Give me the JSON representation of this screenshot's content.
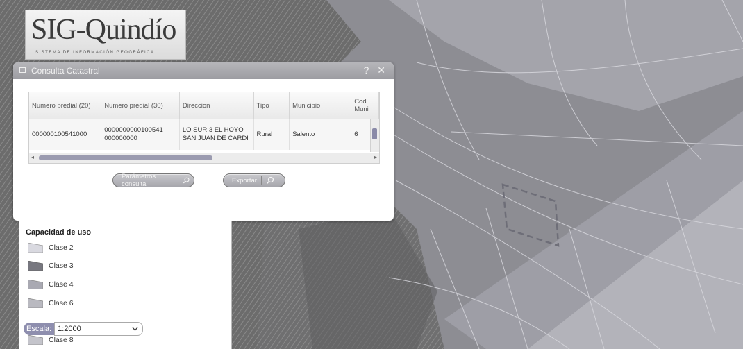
{
  "logo": {
    "title": "SIG-Quindío",
    "subtitle": "SISTEMA DE INFORMACIÓN GEOGRÁFICA"
  },
  "dialog": {
    "title": "Consulta Catastral",
    "controls": {
      "minimize": "–",
      "help": "?",
      "close": "✕"
    },
    "columns": [
      "Numero predial (20)",
      "Numero predial (30)",
      "Direccion",
      "Tipo",
      "Municipio",
      "Cod. Muni"
    ],
    "rows": [
      {
        "numero_predial_20": "000000100541000",
        "numero_predial_30": "0000000000100541 000000000",
        "direccion": "LO SUR 3 EL HOYO SAN JUAN DE CARDI",
        "tipo": "Rural",
        "municipio": "Salento",
        "cod_muni": "6"
      }
    ],
    "buttons": {
      "params": "Parámetros consulta",
      "export": "Exportar"
    }
  },
  "legend": {
    "title": "Capacidad de uso",
    "items": [
      {
        "label": "Clase 2",
        "color": "#d9d9e0"
      },
      {
        "label": "Clase 3",
        "color": "#77777f"
      },
      {
        "label": "Clase 4",
        "color": "#a9a9b2"
      },
      {
        "label": "Clase 6",
        "color": "#b9b9c0"
      },
      {
        "label": "Clase 8",
        "color": "#c4c4cb"
      }
    ]
  },
  "scale": {
    "label": "Escala:",
    "value": "1:2000"
  },
  "colors": {
    "accent": "#8e8eae",
    "dialog_header": "#a7a7ad"
  }
}
